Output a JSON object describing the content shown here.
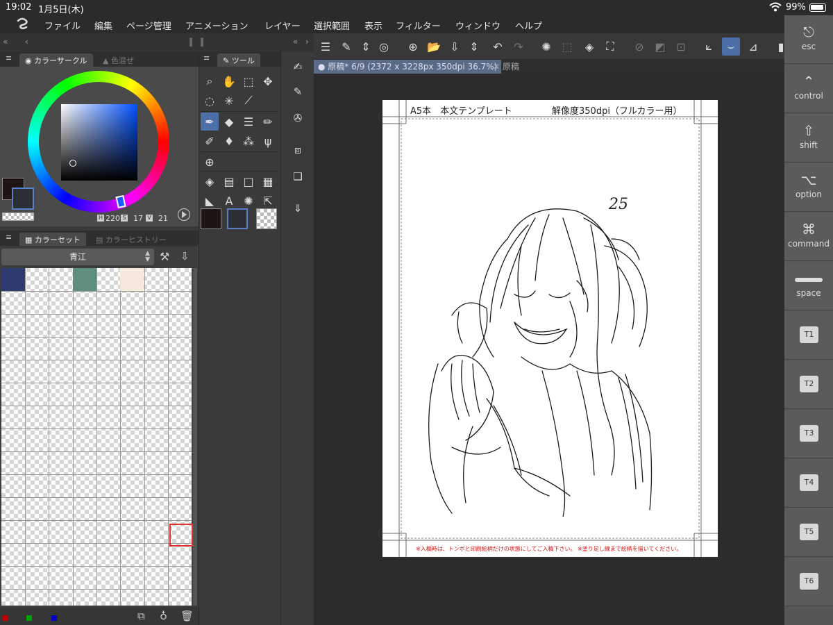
{
  "status": {
    "time": "19:02",
    "date": "1月5日(木)",
    "battery": "99%"
  },
  "menu": [
    "ファイル",
    "編集",
    "ページ管理",
    "アニメーション",
    "レイヤー",
    "選択範囲",
    "表示",
    "フィルター",
    "ウィンドウ",
    "ヘルプ"
  ],
  "color_panel": {
    "tab_active": "カラーサークル",
    "tab_inactive": "色混ぜ",
    "h_label": "H",
    "h": "220",
    "s_label": "S",
    "s": "17",
    "v_label": "V",
    "v": "21",
    "main_color": "#1e1414",
    "sub_color": "#2a2f36"
  },
  "color_set": {
    "tab_active": "カラーセット",
    "tab_inactive": "カラーヒストリー",
    "set_name": "青江",
    "swatches": [
      "#2e3a6e",
      "#5f8e80",
      "#f7e8dc"
    ]
  },
  "tool_panel": {
    "tab": "ツール"
  },
  "doc": {
    "tab_active": "原稿* 6/9 (2372 x 3228px 350dpi 36.7%)",
    "tab_inactive": "原稿"
  },
  "page": {
    "title": "A5本　本文テンプレート",
    "resolution": "解像度350dpi（フルカラー用）",
    "note": "※入稿時は、トンボと印刷絵柄だけの状態にしてご入稿下さい。 ※塗り足し線まで絵柄を描いてください。",
    "number": "25"
  },
  "keys": [
    {
      "glyph": "⎋",
      "label": "esc"
    },
    {
      "glyph": "⌃",
      "label": "control"
    },
    {
      "glyph": "⇧",
      "label": "shift"
    },
    {
      "glyph": "⌥",
      "label": "option"
    },
    {
      "glyph": "⌘",
      "label": "command"
    },
    {
      "glyph": "",
      "label": "space"
    },
    {
      "glyph": "",
      "label": "T1"
    },
    {
      "glyph": "",
      "label": "T2"
    },
    {
      "glyph": "",
      "label": "T3"
    },
    {
      "glyph": "",
      "label": "T4"
    },
    {
      "glyph": "",
      "label": "T5"
    },
    {
      "glyph": "",
      "label": "T6"
    }
  ]
}
